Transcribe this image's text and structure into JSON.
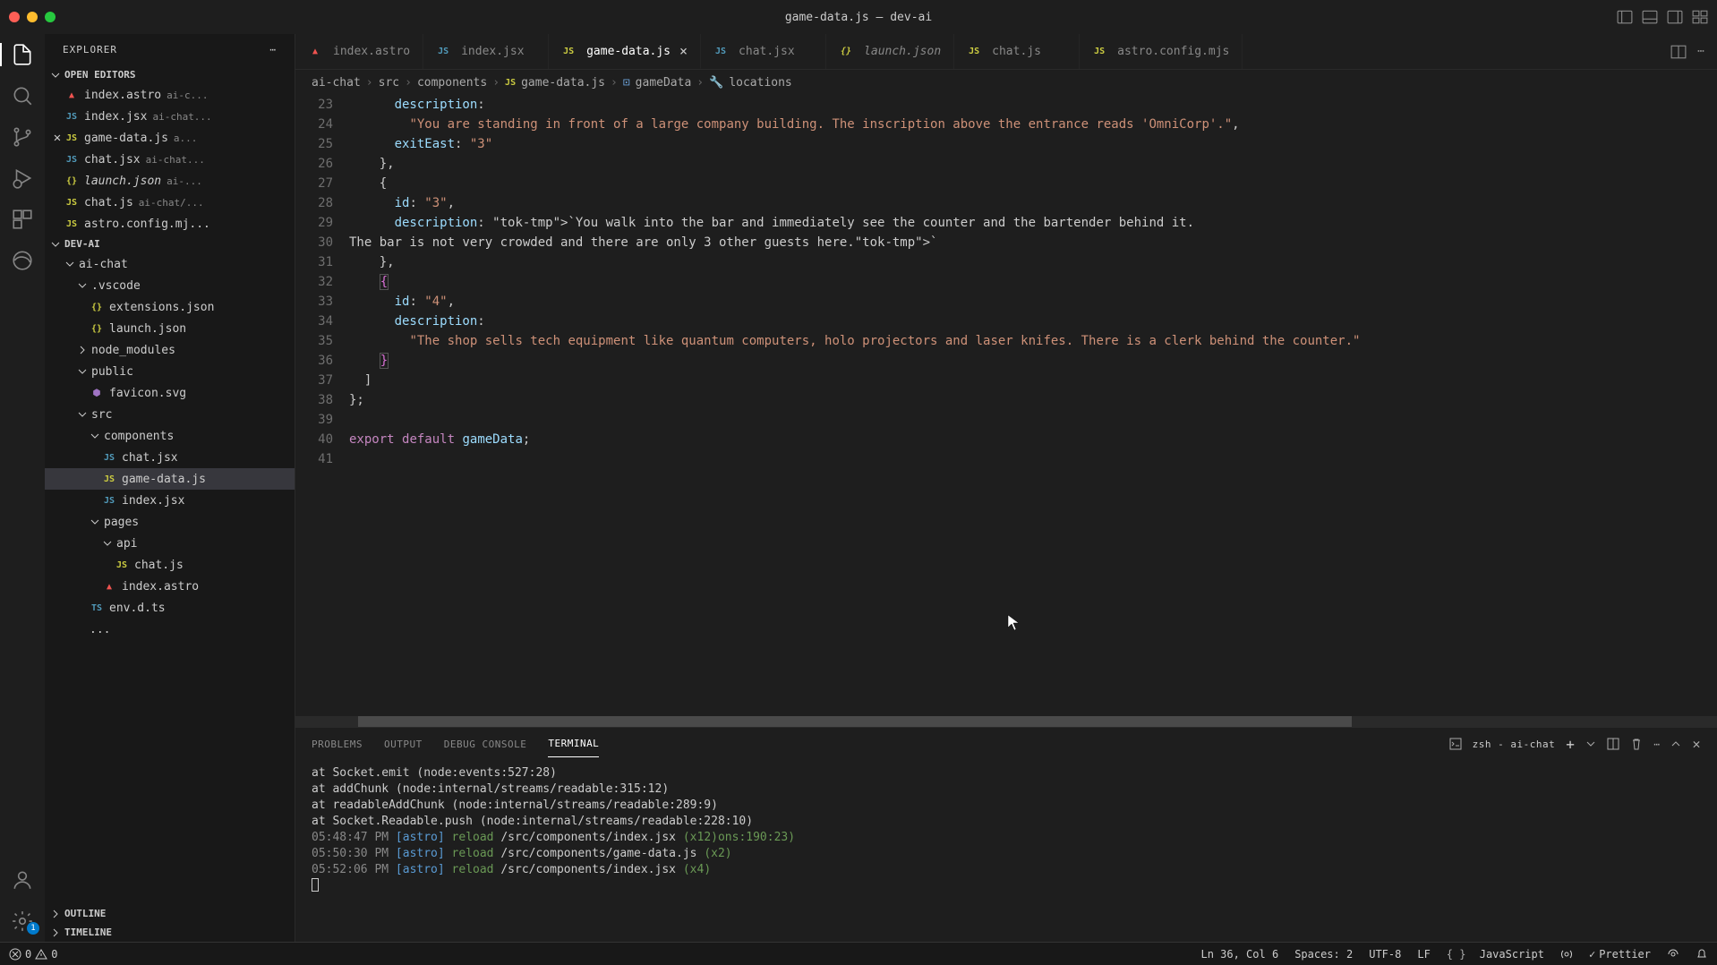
{
  "window": {
    "title": "game-data.js — dev-ai"
  },
  "sidebar": {
    "title": "EXPLORER",
    "sections": {
      "openEditors": "OPEN EDITORS",
      "project": "DEV-AI",
      "outline": "OUTLINE",
      "timeline": "TIMELINE"
    }
  },
  "openEditors": [
    {
      "name": "index.astro",
      "desc": "ai-c...",
      "icon": "astro"
    },
    {
      "name": "index.jsx",
      "desc": "ai-chat...",
      "icon": "jsx"
    },
    {
      "name": "game-data.js",
      "desc": "a...",
      "icon": "js",
      "active": true
    },
    {
      "name": "chat.jsx",
      "desc": "ai-chat...",
      "icon": "jsx"
    },
    {
      "name": "launch.json",
      "desc": "ai-...",
      "icon": "json",
      "italic": true
    },
    {
      "name": "chat.js",
      "desc": "ai-chat/...",
      "icon": "js"
    },
    {
      "name": "astro.config.mj...",
      "desc": "",
      "icon": "js"
    }
  ],
  "fileTree": [
    {
      "type": "folder",
      "name": "ai-chat",
      "depth": 0,
      "open": true
    },
    {
      "type": "folder",
      "name": ".vscode",
      "depth": 1,
      "open": true
    },
    {
      "type": "file",
      "name": "extensions.json",
      "depth": 2,
      "icon": "json"
    },
    {
      "type": "file",
      "name": "launch.json",
      "depth": 2,
      "icon": "json"
    },
    {
      "type": "folder",
      "name": "node_modules",
      "depth": 1,
      "open": false
    },
    {
      "type": "folder",
      "name": "public",
      "depth": 1,
      "open": true
    },
    {
      "type": "file",
      "name": "favicon.svg",
      "depth": 2,
      "icon": "svg"
    },
    {
      "type": "folder",
      "name": "src",
      "depth": 1,
      "open": true
    },
    {
      "type": "folder",
      "name": "components",
      "depth": 2,
      "open": true
    },
    {
      "type": "file",
      "name": "chat.jsx",
      "depth": 3,
      "icon": "jsx"
    },
    {
      "type": "file",
      "name": "game-data.js",
      "depth": 3,
      "icon": "js",
      "selected": true
    },
    {
      "type": "file",
      "name": "index.jsx",
      "depth": 3,
      "icon": "jsx"
    },
    {
      "type": "folder",
      "name": "pages",
      "depth": 2,
      "open": true
    },
    {
      "type": "folder",
      "name": "api",
      "depth": 3,
      "open": true
    },
    {
      "type": "file",
      "name": "chat.js",
      "depth": 4,
      "icon": "js"
    },
    {
      "type": "file",
      "name": "index.astro",
      "depth": 3,
      "icon": "astro"
    },
    {
      "type": "file",
      "name": "env.d.ts",
      "depth": 2,
      "icon": "ts"
    },
    {
      "type": "text",
      "name": "...",
      "depth": 2
    }
  ],
  "tabs": [
    {
      "name": "index.astro",
      "icon": "astro"
    },
    {
      "name": "index.jsx",
      "icon": "jsx"
    },
    {
      "name": "game-data.js",
      "icon": "js",
      "active": true,
      "closable": true
    },
    {
      "name": "chat.jsx",
      "icon": "jsx"
    },
    {
      "name": "launch.json",
      "icon": "json",
      "italic": true
    },
    {
      "name": "chat.js",
      "icon": "js"
    },
    {
      "name": "astro.config.mjs",
      "icon": "js"
    }
  ],
  "breadcrumb": {
    "parts": [
      "ai-chat",
      "src",
      "components",
      "game-data.js",
      "gameData",
      "locations"
    ]
  },
  "code": {
    "startLine": 23,
    "lines": [
      {
        "n": 23,
        "txt": "      description:"
      },
      {
        "n": 24,
        "txt": "        \"You are standing in front of a large company building. The inscription above the entrance reads 'OmniCorp'.\","
      },
      {
        "n": 25,
        "txt": "      exitEast: \"3\""
      },
      {
        "n": 26,
        "txt": "    },"
      },
      {
        "n": 27,
        "txt": "    {"
      },
      {
        "n": 28,
        "txt": "      id: \"3\","
      },
      {
        "n": 29,
        "txt": "      description: `You walk into the bar and immediately see the counter and the bartender behind it."
      },
      {
        "n": 30,
        "txt": "The bar is not very crowded and there are only 3 other guests here.`"
      },
      {
        "n": 31,
        "txt": "    },"
      },
      {
        "n": 32,
        "txt": "    {"
      },
      {
        "n": 33,
        "txt": "      id: \"4\","
      },
      {
        "n": 34,
        "txt": "      description:"
      },
      {
        "n": 35,
        "txt": "        \"The shop sells tech equipment like quantum computers, holo projectors and laser knifes. There is a clerk behind the counter.\""
      },
      {
        "n": 36,
        "txt": "    }"
      },
      {
        "n": 37,
        "txt": "  ]"
      },
      {
        "n": 38,
        "txt": "};"
      },
      {
        "n": 39,
        "txt": ""
      },
      {
        "n": 40,
        "txt": "export default gameData;"
      },
      {
        "n": 41,
        "txt": ""
      }
    ]
  },
  "panel": {
    "tabs": {
      "problems": "PROBLEMS",
      "output": "OUTPUT",
      "debug": "DEBUG CONSOLE",
      "terminal": "TERMINAL"
    },
    "shellLabel": "zsh - ai-chat",
    "lines": [
      "    at Socket.emit (node:events:527:28)",
      "    at addChunk (node:internal/streams/readable:315:12)",
      "    at readableAddChunk (node:internal/streams/readable:289:9)",
      "    at Socket.Readable.push (node:internal/streams/readable:228:10)"
    ],
    "reloads": [
      {
        "time": "05:48:47 PM",
        "path": "/src/components/index.jsx",
        "extra": "(x12)ons:190:23)"
      },
      {
        "time": "05:50:30 PM",
        "path": "/src/components/game-data.js",
        "extra": "(x2)"
      },
      {
        "time": "05:52:06 PM",
        "path": "/src/components/index.jsx",
        "extra": "(x4)"
      }
    ],
    "astroTag": "[astro]",
    "reloadWord": "reload"
  },
  "status": {
    "errors": "0",
    "warnings": "0",
    "cursor": "Ln 36, Col 6",
    "spaces": "Spaces: 2",
    "encoding": "UTF-8",
    "eol": "LF",
    "lang": "JavaScript",
    "prettier": "Prettier"
  }
}
